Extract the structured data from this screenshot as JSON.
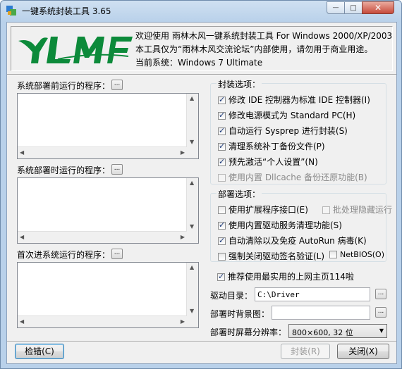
{
  "window": {
    "title": "一键系统封装工具 3.65",
    "controls": {
      "min": "—",
      "max": "□",
      "close": "✕"
    }
  },
  "header": {
    "logo_alt": "YLMF",
    "line1": "欢迎使用 雨林木风一键系统封装工具 For Windows 2000/XP/2003",
    "line2": "本工具仅为“雨林木风交流论坛”内部使用，请勿用于商业用途。",
    "line3": "当前系统：Windows 7 Ultimate"
  },
  "left": {
    "section1_label": "系统部署前运行的程序：",
    "section2_label": "系统部署时运行的程序：",
    "section3_label": "首次进系统运行的程序：",
    "browse": "..."
  },
  "pack_options": {
    "title": "封装选项：",
    "items": [
      {
        "label": "修改 IDE 控制器为标准 IDE 控制器(I)",
        "checked": true,
        "enabled": true
      },
      {
        "label": "修改电源模式为 Standard PC(H)",
        "checked": true,
        "enabled": true
      },
      {
        "label": "自动运行 Sysprep 进行封装(S)",
        "checked": true,
        "enabled": true
      },
      {
        "label": "清理系统补丁备份文件(P)",
        "checked": true,
        "enabled": true
      },
      {
        "label": "预先激活“个人设置”(N)",
        "checked": true,
        "enabled": true
      },
      {
        "label": "使用内置 Dllcache 备份还原功能(B)",
        "checked": false,
        "enabled": false
      }
    ]
  },
  "deploy_options": {
    "title": "部署选项：",
    "items": [
      {
        "label": "使用扩展程序接口(E)",
        "checked": false,
        "enabled": true
      },
      {
        "label": "批处理隐藏运行",
        "checked": false,
        "enabled": false
      },
      {
        "label": "使用内置驱动服务清理功能(S)",
        "checked": true,
        "enabled": true
      },
      {
        "label": "自动清除以及免疫 AutoRun 病毒(K)",
        "checked": true,
        "enabled": true
      },
      {
        "label": "强制关闭驱动签名验证(L)",
        "checked": false,
        "enabled": true
      },
      {
        "label": "NetBIOS(O)",
        "checked": false,
        "enabled": true
      }
    ]
  },
  "homepage_option": {
    "label": "推荐使用最实用的上网主页114啦",
    "checked": true
  },
  "driver_dir": {
    "label": "驱动目录：",
    "value": "C:\\Driver"
  },
  "background": {
    "label": "部署时背景图：",
    "value": ""
  },
  "resolution": {
    "label": "部署时屏幕分辨率：",
    "value": "800×600, 32 位"
  },
  "buttons": {
    "check": "检错(C)",
    "pack": "封装(R)",
    "close": "关闭(X)"
  }
}
